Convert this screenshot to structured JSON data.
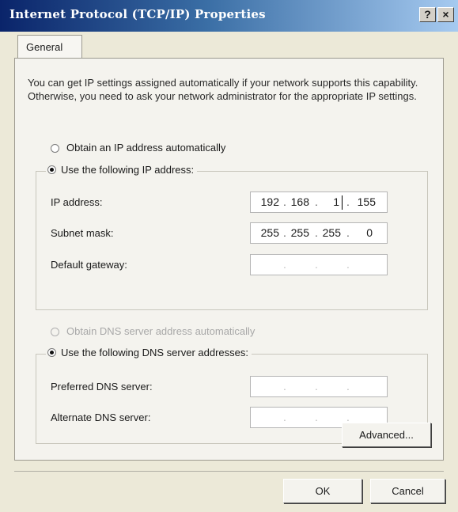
{
  "window": {
    "title": "Internet Protocol (TCP/IP) Properties",
    "help_label": "?",
    "close_label": "×"
  },
  "tabs": [
    {
      "label": "General",
      "selected": true
    }
  ],
  "intro_text": "You can get IP settings assigned automatically if your network supports this capability. Otherwise, you need to ask your network administrator for the appropriate IP settings.",
  "ip_mode": {
    "auto_label": "Obtain an IP address automatically",
    "manual_label": "Use the following IP address:",
    "selected": "manual"
  },
  "ip_fields": {
    "ip_address": {
      "label": "IP address:",
      "octets": [
        "192",
        "168",
        "1",
        "155"
      ]
    },
    "subnet_mask": {
      "label": "Subnet mask:",
      "octets": [
        "255",
        "255",
        "255",
        "0"
      ]
    },
    "default_gateway": {
      "label": "Default gateway:",
      "octets": [
        "",
        "",
        "",
        ""
      ]
    }
  },
  "dns_mode": {
    "auto_label": "Obtain DNS server address automatically",
    "manual_label": "Use the following DNS server addresses:",
    "selected": "manual",
    "auto_disabled": true
  },
  "dns_fields": {
    "preferred": {
      "label": "Preferred DNS server:",
      "octets": [
        "",
        "",
        "",
        ""
      ]
    },
    "alternate": {
      "label": "Alternate DNS server:",
      "octets": [
        "",
        "",
        "",
        ""
      ]
    }
  },
  "buttons": {
    "advanced": "Advanced...",
    "ok": "OK",
    "cancel": "Cancel"
  },
  "colors": {
    "title_gradient_start": "#0a246a",
    "title_gradient_end": "#a6caf0",
    "dialog_background": "#ece9d8"
  }
}
